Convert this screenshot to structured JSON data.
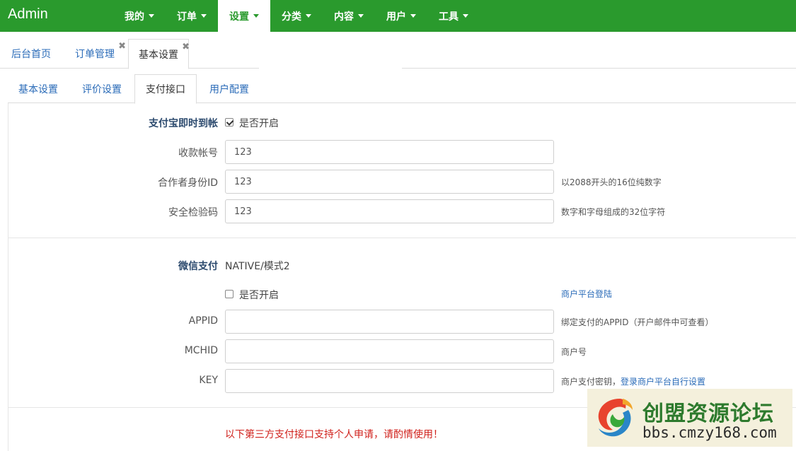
{
  "app": {
    "brand": "Admin"
  },
  "topnav": {
    "items": [
      {
        "label": "我的",
        "active": false
      },
      {
        "label": "订单",
        "active": false
      },
      {
        "label": "设置",
        "active": true
      },
      {
        "label": "分类",
        "active": false
      },
      {
        "label": "内容",
        "active": false
      },
      {
        "label": "用户",
        "active": false
      },
      {
        "label": "工具",
        "active": false
      }
    ]
  },
  "pagetabs": {
    "items": [
      {
        "label": "后台首页",
        "closable": false
      },
      {
        "label": "订单管理",
        "closable": true
      },
      {
        "label": "基本设置",
        "closable": true,
        "active": true
      }
    ],
    "close_glyph": "✖"
  },
  "subtabs": {
    "items": [
      {
        "label": "基本设置"
      },
      {
        "label": "评价设置"
      },
      {
        "label": "支付接口",
        "active": true
      },
      {
        "label": "用户配置"
      }
    ]
  },
  "alipay": {
    "title": "支付宝即时到帐",
    "enabled_label": "是否开启",
    "enabled": true,
    "account_label": "收款帐号",
    "account_value": "123",
    "partner_label": "合作者身份ID",
    "partner_value": "123",
    "partner_hint": "以2088开头的16位纯数字",
    "key_label": "安全检验码",
    "key_value": "123",
    "key_hint": "数字和字母组成的32位字符"
  },
  "wechat": {
    "title": "微信支付",
    "mode": "NATIVE/模式2",
    "enabled_label": "是否开启",
    "enabled": false,
    "merchant_login_link": "商户平台登陆",
    "appid_label": "APPID",
    "appid_value": "",
    "appid_hint": "绑定支付的APPID（开户邮件中可查看）",
    "mchid_label": "MCHID",
    "mchid_value": "",
    "mchid_hint": "商户号",
    "key_label": "KEY",
    "key_value": "",
    "key_hint_prefix": "商户支付密钥，",
    "key_hint_link": "登录商户平台自行设置"
  },
  "third_party": {
    "warning": "以下第三方支付接口支持个人申请，请酌情使用！"
  },
  "watermark": {
    "title": "创盟资源论坛",
    "url": "bbs.cmzy168.com"
  },
  "colors": {
    "nav_green": "#2a9a2d",
    "link_blue": "#2a6bb8",
    "warning_red": "#d0211c"
  }
}
